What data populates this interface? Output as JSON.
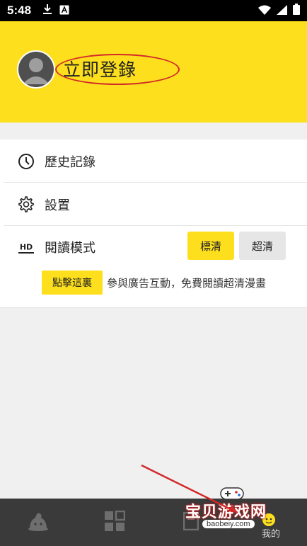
{
  "status_bar": {
    "time": "5:48",
    "icons_left": [
      "download-icon",
      "a-icon"
    ],
    "icons_right": [
      "wifi-icon",
      "signal-icon",
      "battery-icon"
    ]
  },
  "profile": {
    "login_label": "立即登錄"
  },
  "menu": {
    "history_label": "歷史記錄",
    "settings_label": "設置",
    "reading_mode_label": "閱讀模式",
    "reading_mode_icon_text": "HD",
    "quality_standard": "標清",
    "quality_hd": "超清",
    "click_here": "點擊這裏",
    "promo_text": "參與廣告互動，免費閱讀超清漫畫"
  },
  "bottom_nav": {
    "items": [
      "home-icon",
      "grid-icon",
      "shelf-icon",
      "profile-icon"
    ],
    "active_label": "我的"
  },
  "watermark": {
    "title": "宝贝游戏网",
    "site": "baobeiy.com"
  },
  "colors": {
    "accent_yellow": "#fddf1d",
    "annotation_red": "#d12a2a",
    "nav_dark": "#3a3a3a"
  }
}
